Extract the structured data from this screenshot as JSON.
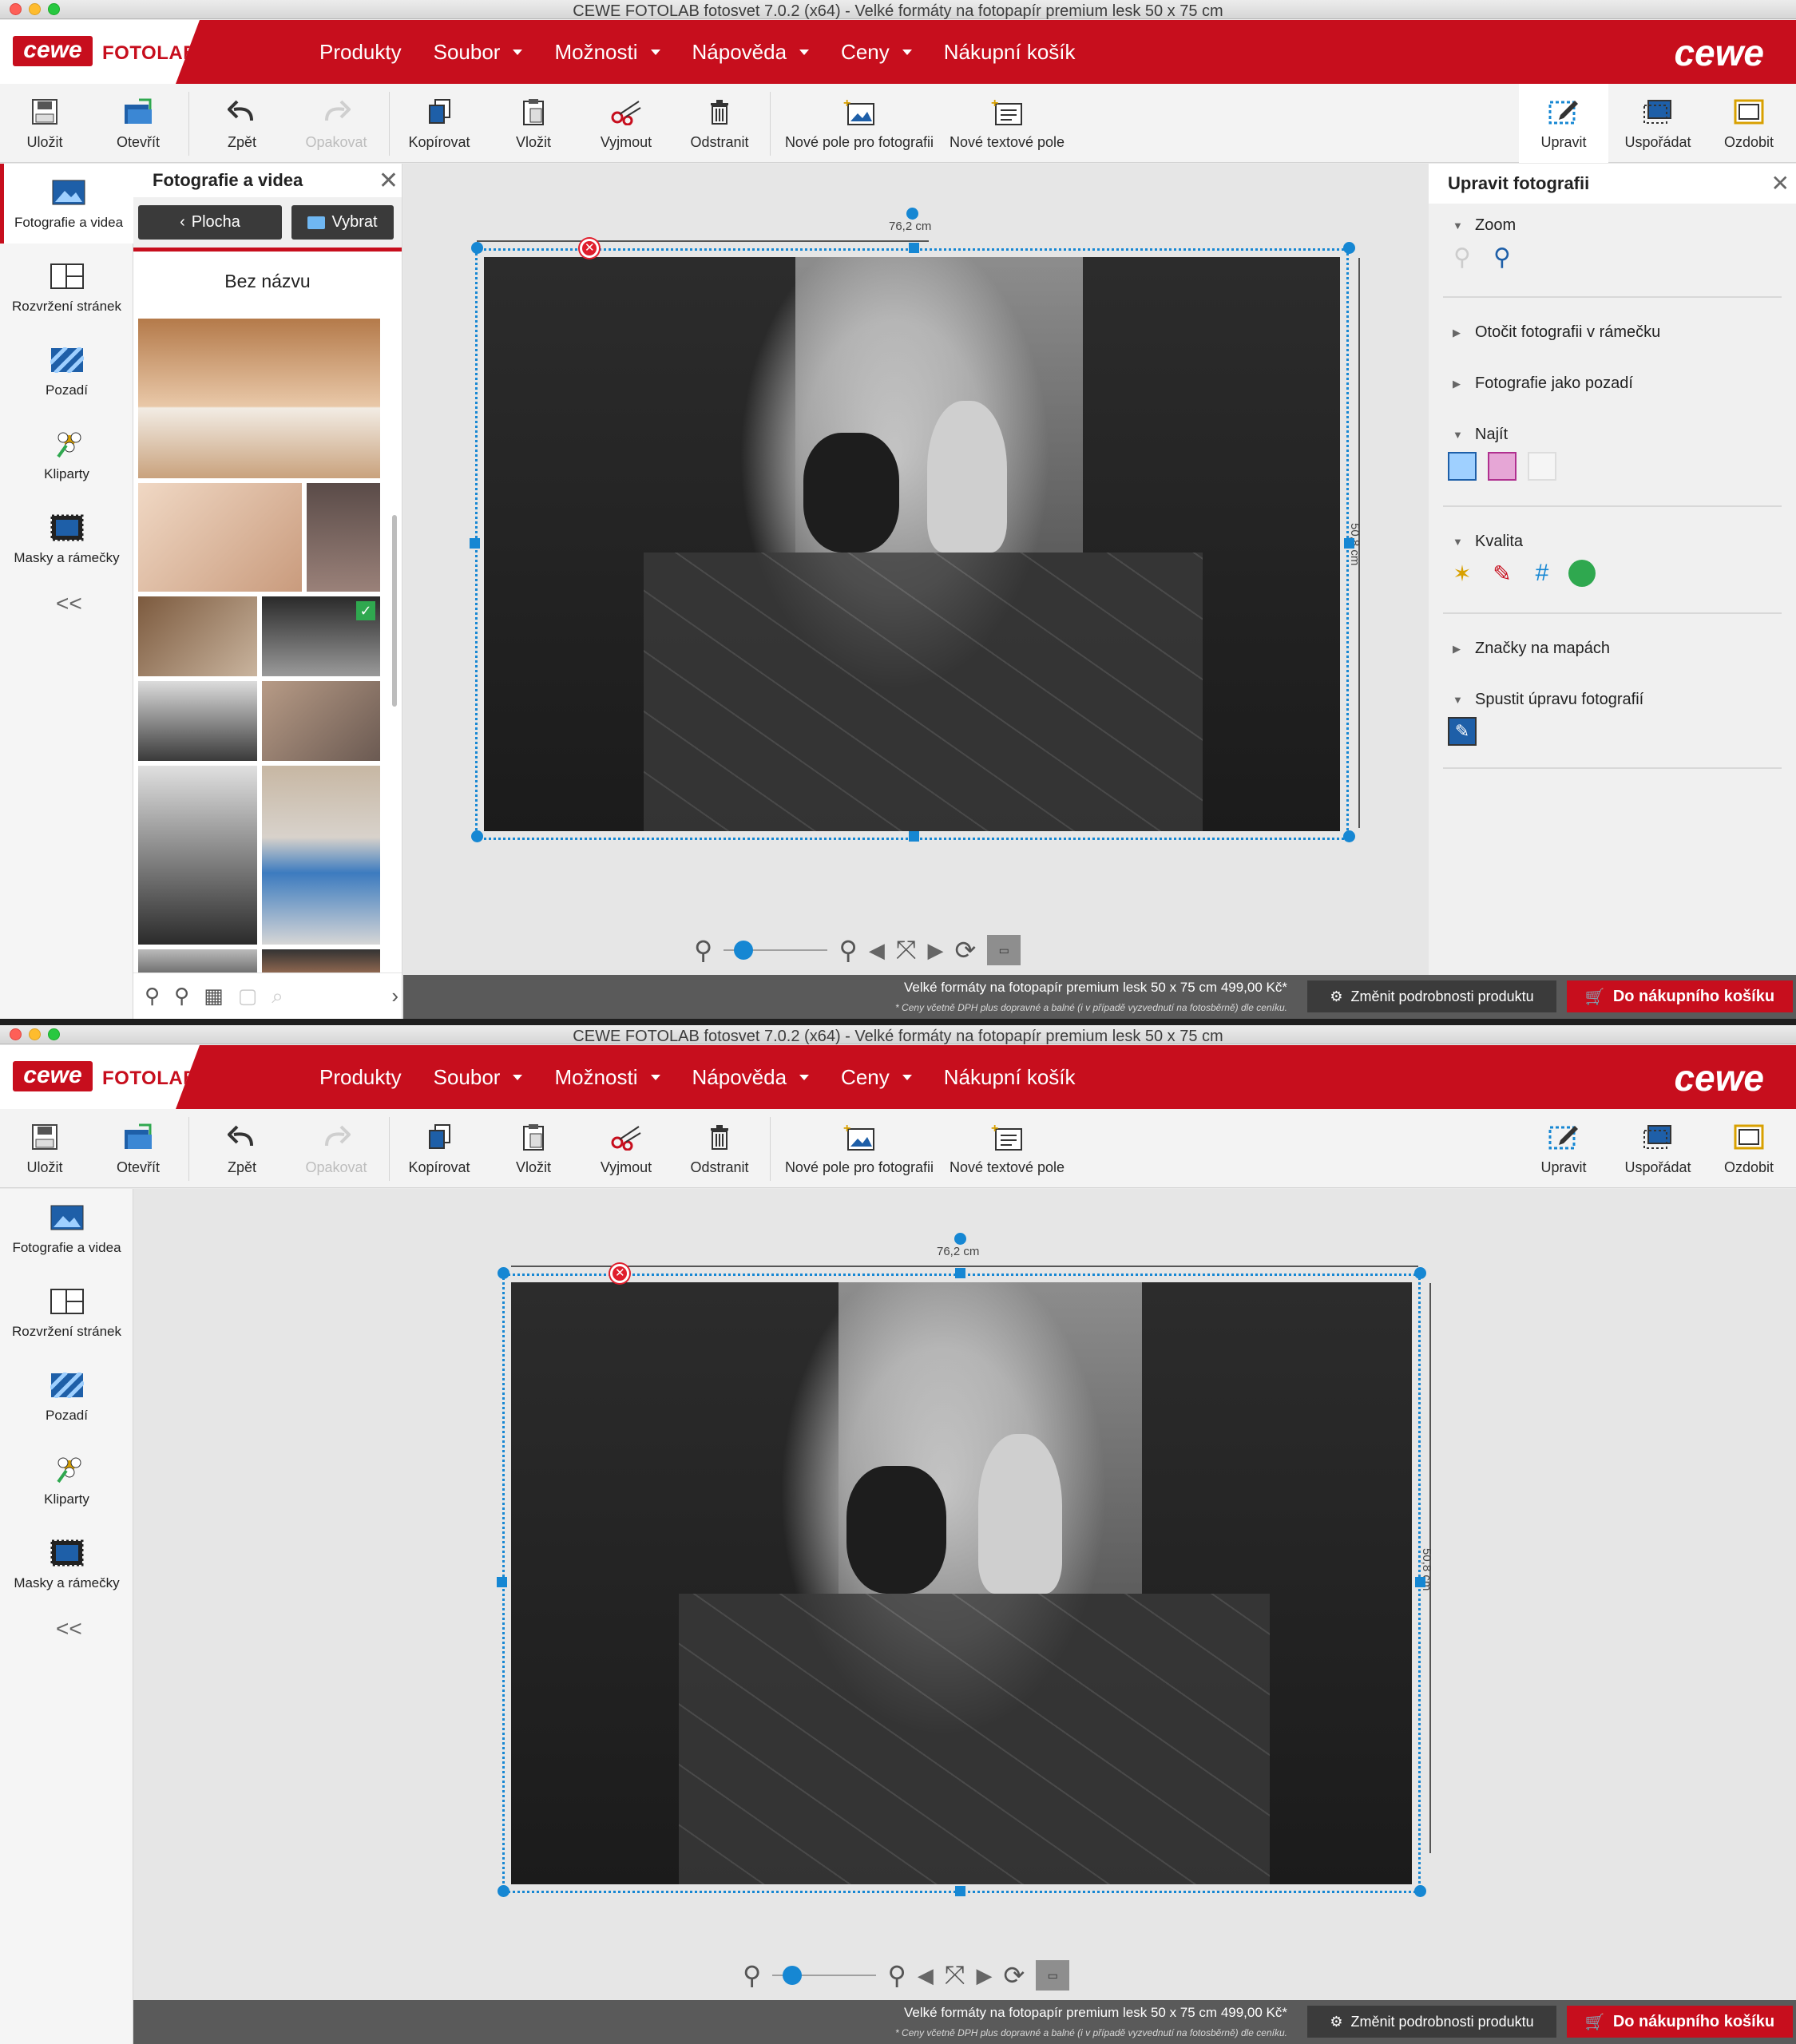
{
  "window_title": "CEWE FOTOLAB fotosvet 7.0.2 (x64) - Velké formáty na fotopapír premium lesk 50 x 75 cm",
  "brand": {
    "logo": "cewe",
    "name": "FOTOLAB",
    "right_logo": "cewe"
  },
  "menu": [
    {
      "label": "Produkty",
      "dropdown": false
    },
    {
      "label": "Soubor",
      "dropdown": true
    },
    {
      "label": "Možnosti",
      "dropdown": true
    },
    {
      "label": "Nápověda",
      "dropdown": true
    },
    {
      "label": "Ceny",
      "dropdown": true
    },
    {
      "label": "Nákupní košík",
      "dropdown": false
    }
  ],
  "toolbar": {
    "save": "Uložit",
    "open": "Otevřít",
    "undo": "Zpět",
    "redo": "Opakovat",
    "copy": "Kopírovat",
    "paste": "Vložit",
    "cut": "Vyjmout",
    "delete": "Odstranit",
    "new_photo_field": "Nové pole pro fotografii",
    "new_text_field": "Nové textové pole",
    "edit": "Upravit",
    "arrange": "Uspořádat",
    "decorate": "Ozdobit"
  },
  "leftbar": {
    "items": [
      {
        "label": "Fotografie a videa",
        "icon": "photo-icon"
      },
      {
        "label": "Rozvržení stránek",
        "icon": "layout-icon"
      },
      {
        "label": "Pozadí",
        "icon": "background-icon"
      },
      {
        "label": "Kliparty",
        "icon": "clipart-icon"
      },
      {
        "label": "Masky a rámečky",
        "icon": "mask-frame-icon"
      }
    ],
    "collapse": "<<"
  },
  "photos_panel": {
    "title": "Fotografie a videa",
    "back_button": "Plocha",
    "select_button": "Vybrat",
    "album_name": "Bez názvu"
  },
  "canvas": {
    "width_label": "76,2 cm",
    "height_label": "50,8 cm",
    "zoom_level": 0.1
  },
  "right_panel": {
    "title": "Upravit fotografii",
    "sections": {
      "zoom": "Zoom",
      "rotate": "Otočit fotografii v rámečku",
      "as_background": "Fotografie jako pozadí",
      "find": "Najít",
      "quality": "Kvalita",
      "map_markers": "Značky na mapách",
      "start_editing": "Spustit úpravu fotografií"
    }
  },
  "status": {
    "product_price": "Velké formáty na fotopapír premium lesk 50 x 75 cm 499,00 Kč*",
    "price_note": "* Ceny včetně DPH plus dopravné a balné (i v případě vyzvednutí na fotosběrně) dle ceníku.",
    "change_product": "Změnit podrobnosti produktu",
    "add_to_cart": "Do nákupního košíku"
  },
  "colors": {
    "brand_red": "#c70e1d",
    "selection_blue": "#1687d3",
    "check_green": "#2fa84f"
  }
}
